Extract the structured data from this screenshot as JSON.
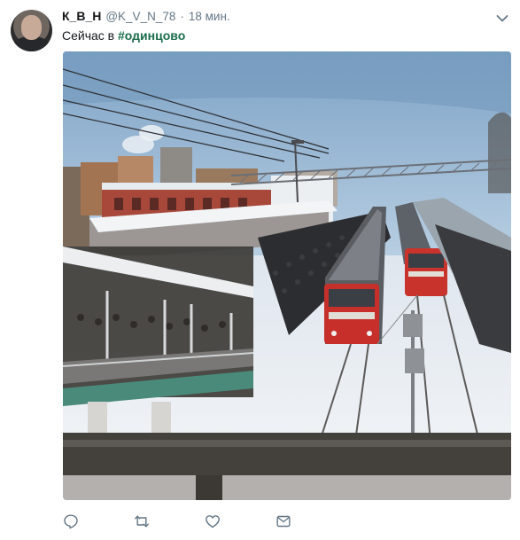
{
  "tweet": {
    "author_name": "К_В_Н",
    "handle": "@K_V_N_78",
    "separator": "·",
    "timestamp": "18 мин.",
    "text_prefix": "Сейчас в ",
    "hashtag": "#одинцово"
  },
  "icons": {
    "caret": "chevron-down-icon",
    "reply": "reply-icon",
    "retweet": "retweet-icon",
    "like": "heart-icon",
    "message": "envelope-icon"
  },
  "colors": {
    "hashtag": "#1b6d4b",
    "muted": "#657786",
    "icon": "#657786"
  }
}
